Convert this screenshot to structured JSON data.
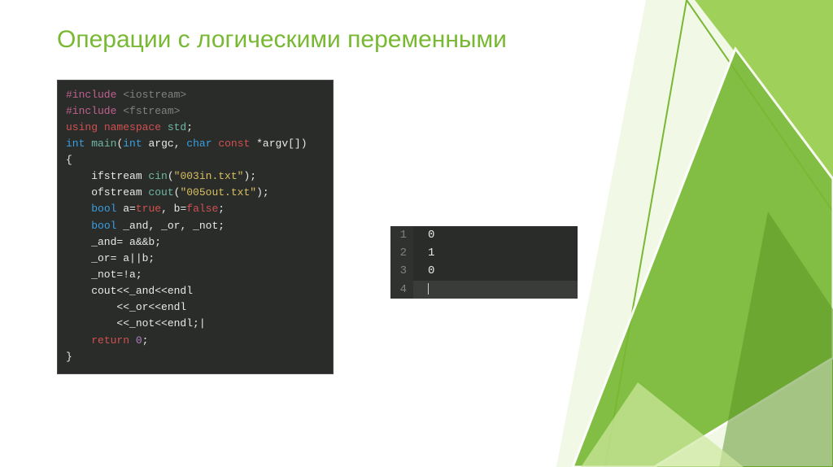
{
  "slide": {
    "title": "Операции с логическими переменными"
  },
  "code": {
    "l1a": "#include ",
    "l1b": "<iostream>",
    "l2a": "#include ",
    "l2b": "<fstream>",
    "l3": "",
    "l4a": "using ",
    "l4b": "namespace ",
    "l4c": "std",
    "l4d": ";",
    "l5": "",
    "l6a": "int ",
    "l6b": "main",
    "l6c": "(",
    "l6d": "int ",
    "l6e": "argc",
    "l6f": ", ",
    "l6g": "char ",
    "l6h": "const ",
    "l6i": "*argv[])",
    "l7": "{",
    "l8a": "    ifstream ",
    "l8b": "cin",
    "l8c": "(",
    "l8d": "\"003in.txt\"",
    "l8e": ");",
    "l9a": "    ofstream ",
    "l9b": "cout",
    "l9c": "(",
    "l9d": "\"005out.txt\"",
    "l9e": ");",
    "l10": "",
    "l11a": "    ",
    "l11b": "bool ",
    "l11c": "a=",
    "l11d": "true",
    "l11e": ", b=",
    "l11f": "false",
    "l11g": ";",
    "l12a": "    ",
    "l12b": "bool ",
    "l12c": "_and, _or, _not;",
    "l13": "    _and= a&&b;",
    "l14": "    _or= a||b;",
    "l15": "    _not=!a;",
    "l16": "    cout<<_and<<endl",
    "l17": "        <<_or<<endl",
    "l18": "        <<_not<<endl;|",
    "l19a": "    ",
    "l19b": "return ",
    "l19c": "0",
    "l19d": ";",
    "l20": "}"
  },
  "output": {
    "lines": [
      {
        "n": "1",
        "v": "0"
      },
      {
        "n": "2",
        "v": "1"
      },
      {
        "n": "3",
        "v": "0"
      },
      {
        "n": "4",
        "v": ""
      }
    ]
  }
}
